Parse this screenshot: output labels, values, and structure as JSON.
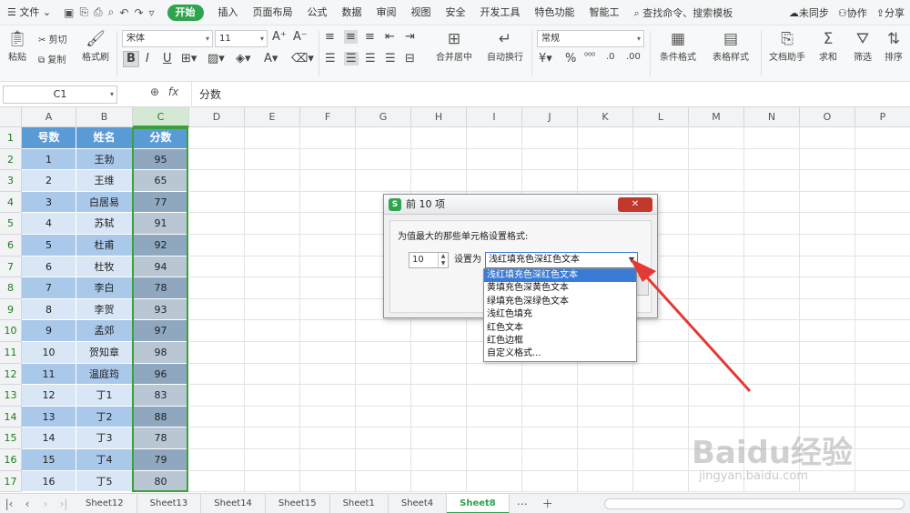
{
  "menu": {
    "file_label": "文件",
    "start_label": "开始",
    "tabs": [
      "插入",
      "页面布局",
      "公式",
      "数据",
      "审阅",
      "视图",
      "安全",
      "开发工具",
      "特色功能",
      "智能工"
    ],
    "search_label": "查找命令、搜索模板",
    "sync_label": "未同步",
    "collab_label": "协作",
    "share_label": "分享"
  },
  "ribbon": {
    "paste": "粘贴",
    "cut": "剪切",
    "copy": "复制",
    "format_painter": "格式刷",
    "font_name": "宋体",
    "font_size": "11",
    "merge_center": "合并居中",
    "wrap_text": "自动换行",
    "number_format": "常规",
    "conditional_format": "条件格式",
    "table_style": "表格样式",
    "doc_helper": "文档助手",
    "sum": "求和",
    "filter": "筛选",
    "sort": "排序"
  },
  "formula_bar": {
    "name_box": "C1",
    "fx_label": "fx",
    "value": "分数"
  },
  "columns": [
    "A",
    "B",
    "C",
    "D",
    "E",
    "F",
    "G",
    "H",
    "I",
    "J",
    "K",
    "L",
    "M",
    "N",
    "O",
    "P"
  ],
  "rows": [
    "1",
    "2",
    "3",
    "4",
    "5",
    "6",
    "7",
    "8",
    "9",
    "10",
    "11",
    "12",
    "13",
    "14",
    "15",
    "16",
    "17"
  ],
  "table": {
    "headers": [
      "号数",
      "姓名",
      "分数"
    ],
    "data": [
      [
        "1",
        "王勃",
        "95"
      ],
      [
        "2",
        "王维",
        "65"
      ],
      [
        "3",
        "白居易",
        "77"
      ],
      [
        "4",
        "苏轼",
        "91"
      ],
      [
        "5",
        "杜甫",
        "92"
      ],
      [
        "6",
        "杜牧",
        "94"
      ],
      [
        "7",
        "李白",
        "78"
      ],
      [
        "8",
        "李贺",
        "93"
      ],
      [
        "9",
        "孟郊",
        "97"
      ],
      [
        "10",
        "贺知章",
        "98"
      ],
      [
        "11",
        "温庭筠",
        "96"
      ],
      [
        "12",
        "丁1",
        "83"
      ],
      [
        "13",
        "丁2",
        "88"
      ],
      [
        "14",
        "丁3",
        "78"
      ],
      [
        "15",
        "丁4",
        "79"
      ],
      [
        "16",
        "丁5",
        "80"
      ]
    ]
  },
  "sheets": {
    "tabs": [
      "Sheet12",
      "Sheet13",
      "Sheet14",
      "Sheet15",
      "Sheet1",
      "Sheet4",
      "Sheet8"
    ],
    "active": "Sheet8"
  },
  "dialog": {
    "title": "前 10 项",
    "prompt": "为值最大的那些单元格设置格式:",
    "count": "10",
    "set_as_label": "设置为",
    "selected": "浅红填充色深红色文本",
    "options": [
      "浅红填充色深红色文本",
      "黄填充色深黄色文本",
      "绿填充色深绿色文本",
      "浅红色填充",
      "红色文本",
      "红色边框",
      "自定义格式..."
    ]
  },
  "watermark": {
    "brand": "Baidu经验",
    "url": "jingyan.baidu.com"
  },
  "colors": {
    "accent_green": "#2ea44f",
    "header_blue": "#5b9bd5",
    "arrow_red": "#e53935"
  }
}
